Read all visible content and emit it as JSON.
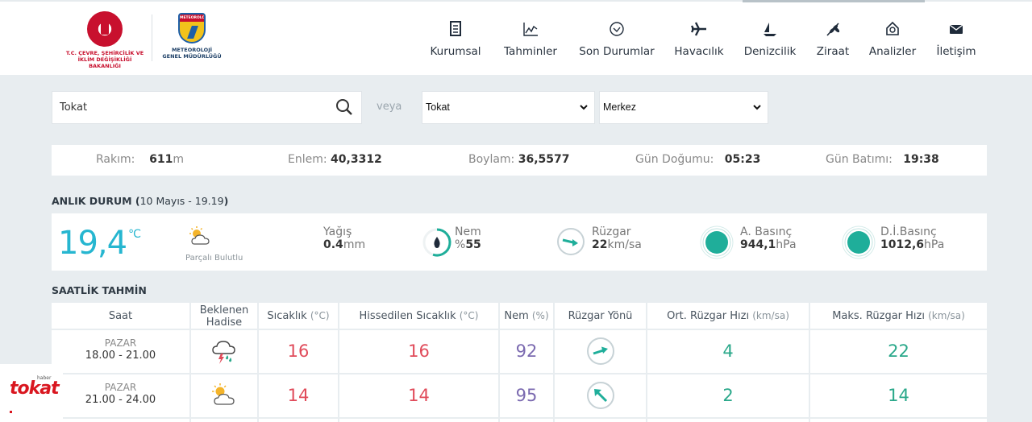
{
  "header": {
    "ministry_name_line1": "T.C. ÇEVRE, ŞEHİRCİLİK VE",
    "ministry_name_line2": "İKLİM DEĞİŞİKLİĞİ BAKANLIĞI",
    "mgm_badge": "METEOROLOJI",
    "mgm_name_line1": "METEOROLOJİ",
    "mgm_name_line2": "GENEL MÜDÜRLÜĞÜ",
    "nav": [
      {
        "label": "Kurumsal",
        "icon": "building-icon"
      },
      {
        "label": "Tahminler",
        "icon": "chart-icon"
      },
      {
        "label": "Son Durumlar",
        "icon": "check-circle-icon"
      },
      {
        "label": "Havacılık",
        "icon": "plane-icon"
      },
      {
        "label": "Denizcilik",
        "icon": "sailboat-icon"
      },
      {
        "label": "Ziraat",
        "icon": "wheat-icon"
      },
      {
        "label": "Analizler",
        "icon": "analysis-icon"
      },
      {
        "label": "İletişim",
        "icon": "mail-icon"
      }
    ]
  },
  "search": {
    "value": "Tokat",
    "or_label": "veya",
    "province_selected": "Tokat",
    "district_selected": "Merkez"
  },
  "location": {
    "altitude_label": "Rakım:",
    "altitude_value": "611",
    "altitude_unit": "m",
    "latitude_label": "Enlem:",
    "latitude_value": "40,3312",
    "longitude_label": "Boylam:",
    "longitude_value": "36,5577",
    "sunrise_label": "Gün Doğumu:",
    "sunrise_value": "05:23",
    "sunset_label": "Gün Batımı:",
    "sunset_value": "19:38"
  },
  "current": {
    "title": "ANLIK DURUM",
    "paren_open": "(",
    "timestamp": "10 Mayıs - 19.19",
    "paren_close": ")",
    "temperature": "19,4",
    "temp_unit": "°C",
    "condition": "Parçalı Bulutlu",
    "precip_label": "Yağış",
    "precip_value": "0.4",
    "precip_unit": "mm",
    "humidity_label": "Nem",
    "humidity_prefix": "%",
    "humidity_value": "55",
    "humidity_fraction": 0.55,
    "wind_label": "Rüzgar",
    "wind_value": "22",
    "wind_unit": "km/sa",
    "pressure_label": "A. Basınç",
    "pressure_value": "944,1",
    "pressure_unit": "hPa",
    "sea_pressure_label": "D.İ.Basınç",
    "sea_pressure_value": "1012,6",
    "sea_pressure_unit": "hPa"
  },
  "hourly": {
    "title": "SAATLİK TAHMİN",
    "headers": {
      "time": "Saat",
      "event_l1": "Beklenen",
      "event_l2": "Hadise",
      "temp": "Sıcaklık",
      "temp_unit": "(°C)",
      "feels": "Hissedilen Sıcaklık",
      "feels_unit": "(°C)",
      "humidity": "Nem",
      "humidity_unit": "(%)",
      "wind_dir": "Rüzgar Yönü",
      "avg_wind": "Ort. Rüzgar Hızı",
      "avg_wind_unit": "(km/sa)",
      "max_wind": "Maks. Rüzgar Hızı",
      "max_wind_unit": "(km/sa)"
    },
    "rows": [
      {
        "day": "PAZAR",
        "time": "18.00 - 21.00",
        "event": "thunderstorm-icon",
        "temp": "16",
        "feels": "16",
        "humidity": "92",
        "wind_dir": "east-northeast-arrow-icon",
        "avg_wind": "4",
        "max_wind": "22"
      },
      {
        "day": "PAZAR",
        "time": "21.00 - 24.00",
        "event": "partly-cloudy-icon",
        "temp": "14",
        "feels": "14",
        "humidity": "95",
        "wind_dir": "northwest-arrow-icon",
        "avg_wind": "2",
        "max_wind": "14"
      }
    ]
  },
  "watermark": {
    "small": "haber",
    "brand": "tokat"
  },
  "colors": {
    "accent_teal": "#26b6d0",
    "temp_red": "#e04b5a",
    "humidity_purple": "#7b6ab0",
    "wind_green": "#2aa88a",
    "gauge_teal": "#1fae9a"
  }
}
